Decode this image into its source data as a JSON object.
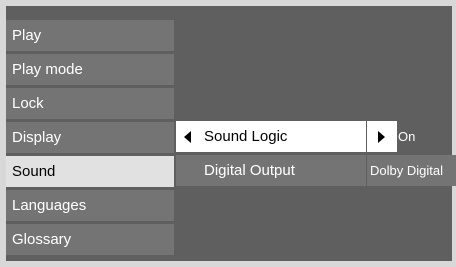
{
  "menu": {
    "items": [
      {
        "label": "Play"
      },
      {
        "label": "Play mode"
      },
      {
        "label": "Lock"
      },
      {
        "label": "Display"
      },
      {
        "label": "Sound"
      },
      {
        "label": "Languages"
      },
      {
        "label": "Glossary"
      }
    ],
    "selected_label": "Sound"
  },
  "submenu": {
    "rows": [
      {
        "label": "Sound Logic",
        "value": "On"
      },
      {
        "label": "Digital Output",
        "value": "Dolby Digital"
      }
    ]
  },
  "colors": {
    "background": "#5f5f5f",
    "item": "#747474",
    "selected_item": "#e1e1e1",
    "active_row": "#ffffff",
    "frame": "#d8d8d8"
  },
  "icons": {
    "left": "left-arrow-icon",
    "right": "right-arrow-icon"
  }
}
